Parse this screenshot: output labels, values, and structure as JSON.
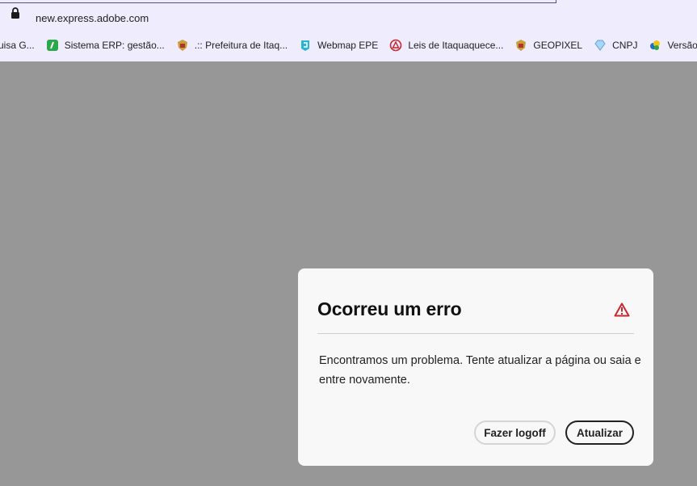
{
  "browser": {
    "url": "new.express.adobe.com",
    "bookmarks": [
      {
        "label": "uisa G...",
        "icon": "page-icon"
      },
      {
        "label": "Sistema ERP: gestão...",
        "icon": "erp-icon"
      },
      {
        "label": ".:: Prefeitura de Itaq...",
        "icon": "crest-icon"
      },
      {
        "label": "Webmap EPE",
        "icon": "webmap-icon"
      },
      {
        "label": "Leis de Itaquaquece...",
        "icon": "leis-icon"
      },
      {
        "label": "GEOPIXEL",
        "icon": "crest-icon"
      },
      {
        "label": "CNPJ",
        "icon": "diamond-icon"
      },
      {
        "label": "Versão para Cart",
        "icon": "gov-icon"
      }
    ]
  },
  "dialog": {
    "title": "Ocorreu um erro",
    "message": "Encontramos um problema. Tente atualizar a página ou saia e entre novamente.",
    "logoff_label": "Fazer logoff",
    "refresh_label": "Atualizar"
  },
  "colors": {
    "overlay": "#979797",
    "alert": "#c9252d",
    "dialog_bg": "#f8f8f8"
  }
}
